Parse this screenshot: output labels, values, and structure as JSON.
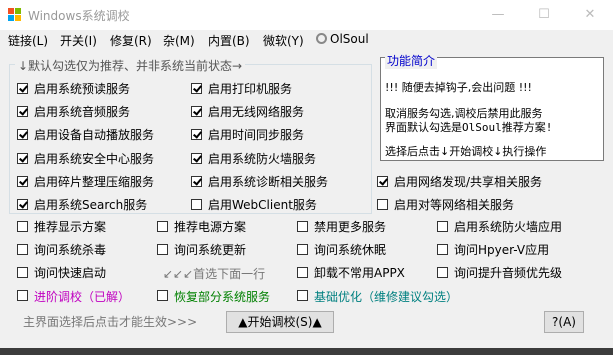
{
  "window": {
    "title": "Windows系统调校",
    "minimize": "—",
    "maximize": "☐",
    "close": "✕"
  },
  "menu": [
    {
      "label": "链接(L)"
    },
    {
      "label": "开关(I)"
    },
    {
      "label": "修复(R)"
    },
    {
      "label": "杂(M)"
    },
    {
      "label": "内置(B)"
    },
    {
      "label": "微软(Y)"
    },
    {
      "label": "OlSoul"
    }
  ],
  "panel_title": "↓默认勾选仅为推荐、并非系统当前状态→",
  "info": {
    "title": "功能简介",
    "line1": "!!! 随便去掉钩子,会出问题 !!!",
    "line2": "取消服务勾选,调校后禁用此服务",
    "line3": "界面默认勾选是OlSoul推荐方案!",
    "line4": "选择后点击↓开始调校↓执行操作"
  },
  "checkboxes": [
    {
      "label": "启用系统预读服务",
      "checked": true
    },
    {
      "label": "启用打印机服务",
      "checked": true
    },
    {
      "label": "启用系统音频服务",
      "checked": true
    },
    {
      "label": "启用无线网络服务",
      "checked": true
    },
    {
      "label": "启用设备自动播放服务",
      "checked": true
    },
    {
      "label": "启用时间同步服务",
      "checked": true
    },
    {
      "label": "启用系统安全中心服务",
      "checked": true
    },
    {
      "label": "启用系统防火墙服务",
      "checked": true
    },
    {
      "label": "启用碎片整理压缩服务",
      "checked": true
    },
    {
      "label": "启用系统诊断相关服务",
      "checked": true
    },
    {
      "label": "启用网络发现/共享相关服务",
      "checked": true
    },
    {
      "label": "启用系统Search服务",
      "checked": true
    },
    {
      "label": "启用WebClient服务",
      "checked": false
    },
    {
      "label": "启用对等网络相关服务",
      "checked": false
    },
    {
      "label": "推荐显示方案",
      "checked": false
    },
    {
      "label": "推荐电源方案",
      "checked": false
    },
    {
      "label": "禁用更多服务",
      "checked": false
    },
    {
      "label": "启用系统防火墙应用",
      "checked": false
    },
    {
      "label": "询问系统杀毒",
      "checked": false
    },
    {
      "label": "询问系统更新",
      "checked": false
    },
    {
      "label": "询问系统休眠",
      "checked": false
    },
    {
      "label": "询问Hpyer-V应用",
      "checked": false
    },
    {
      "label": "询问快速启动",
      "checked": false
    },
    {
      "label": "卸载不常用APPX",
      "checked": false
    },
    {
      "label": "询问提升音频优先级",
      "checked": false
    }
  ],
  "hint": "↙↙↙首选下面一行",
  "links": [
    {
      "label": "进阶调校（已解）",
      "color": "#c000c0"
    },
    {
      "label": "恢复部分系统服务",
      "color": "#008000"
    },
    {
      "label": "基础优化（维修建议勾选）",
      "color": "#008080"
    }
  ],
  "footer_note": "主界面选择后点击才能生效>>>",
  "start_button": "▲开始调校(S)▲",
  "help_button": "?(A)"
}
